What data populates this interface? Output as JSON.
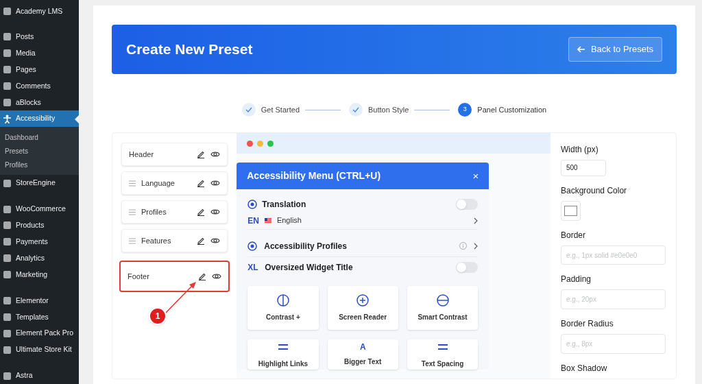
{
  "sidebar": {
    "items": [
      {
        "label": "Academy LMS",
        "selected": false
      },
      {
        "label": "Posts",
        "selected": false
      },
      {
        "label": "Media",
        "selected": false
      },
      {
        "label": "Pages",
        "selected": false
      },
      {
        "label": "Comments",
        "selected": false
      },
      {
        "label": "aBlocks",
        "selected": false
      },
      {
        "label": "Accessibility",
        "selected": true,
        "children": [
          {
            "label": "Dashboard"
          },
          {
            "label": "Presets"
          },
          {
            "label": "Profiles"
          }
        ]
      },
      {
        "label": "StoreEngine",
        "selected": false
      },
      {
        "label": "WooCommerce",
        "selected": false
      },
      {
        "label": "Products",
        "selected": false
      },
      {
        "label": "Payments",
        "selected": false
      },
      {
        "label": "Analytics",
        "selected": false
      },
      {
        "label": "Marketing",
        "selected": false
      },
      {
        "label": "Elementor",
        "selected": false
      },
      {
        "label": "Templates",
        "selected": false
      },
      {
        "label": "Element Pack Pro",
        "selected": false
      },
      {
        "label": "Ultimate Store Kit",
        "selected": false
      },
      {
        "label": "Astra",
        "selected": false
      }
    ]
  },
  "banner": {
    "title": "Create New Preset",
    "back_button": "Back to Presets"
  },
  "stepper": [
    {
      "label": "Get Started",
      "done": true
    },
    {
      "label": "Button Style",
      "done": true
    },
    {
      "number": "3",
      "label": "Panel Customization",
      "done": false
    }
  ],
  "sections": [
    {
      "label": "Header",
      "kind": "fixed",
      "highlighted": false
    },
    {
      "label": "Language",
      "kind": "draggable",
      "highlighted": false
    },
    {
      "label": "Profiles",
      "kind": "draggable",
      "highlighted": false
    },
    {
      "label": "Features",
      "kind": "draggable",
      "highlighted": false
    },
    {
      "label": "Footer",
      "kind": "fixed",
      "highlighted": true
    }
  ],
  "annotation": {
    "number": "1"
  },
  "preview": {
    "menu_title": "Accessibility Menu (CTRL+U)",
    "close": "×",
    "rows": [
      {
        "kind": "toggle",
        "label": "Translation",
        "on": false
      },
      {
        "kind": "language",
        "code": "EN",
        "label": "English"
      },
      {
        "kind": "link",
        "label": "Accessibility Profiles"
      },
      {
        "kind": "toggle",
        "icon_text": "XL",
        "label": "Oversized Widget Title",
        "on": false
      }
    ],
    "tiles": [
      {
        "label": "Contrast +"
      },
      {
        "label": "Screen Reader"
      },
      {
        "label": "Smart Contrast"
      },
      {
        "label": "Highlight Links"
      },
      {
        "label": "Bigger Text",
        "icon_text": "A"
      },
      {
        "label": "Text Spacing"
      }
    ]
  },
  "settings": [
    {
      "kind": "input",
      "label": "Width (px)",
      "value": "500"
    },
    {
      "kind": "color",
      "label": "Background Color"
    },
    {
      "kind": "input",
      "label": "Border",
      "placeholder": "e.g., 1px solid #e0e0e0"
    },
    {
      "kind": "input",
      "label": "Padding",
      "placeholder": "e.g., 20px"
    },
    {
      "kind": "input",
      "label": "Border Radius",
      "placeholder": "e.g., 8px"
    },
    {
      "kind": "label",
      "label": "Box Shadow"
    }
  ]
}
